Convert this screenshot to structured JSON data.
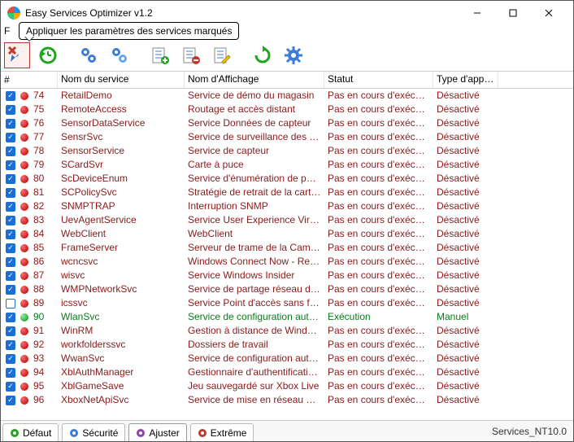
{
  "window": {
    "title": "Easy Services Optimizer v1.2",
    "letter": "F"
  },
  "tooltip": "Appliquer les paramètres des services marqués",
  "toolbar": {
    "apply": "apply-marked",
    "restore": "restore-defaults",
    "service1": "service-settings-1",
    "service2": "service-settings-2",
    "listAdd": "list-add",
    "listRemove": "list-remove",
    "listEdit": "list-edit",
    "refresh": "refresh",
    "options": "options"
  },
  "columns": {
    "idx": "#",
    "name": "Nom du service",
    "display": "Nom d'Affichage",
    "status": "Statut",
    "type": "Type d'appli..."
  },
  "rows": [
    {
      "n": 74,
      "chk": true,
      "color": "red",
      "name": "RetailDemo",
      "disp": "Service de démo du magasin",
      "stat": "Pas en cours d'exécution",
      "type": "Désactivé",
      "cls": "stopped"
    },
    {
      "n": 75,
      "chk": true,
      "color": "red",
      "name": "RemoteAccess",
      "disp": "Routage et accès distant",
      "stat": "Pas en cours d'exécution",
      "type": "Désactivé",
      "cls": "stopped"
    },
    {
      "n": 76,
      "chk": true,
      "color": "red",
      "name": "SensorDataService",
      "disp": "Service Données de capteur",
      "stat": "Pas en cours d'exécution",
      "type": "Désactivé",
      "cls": "stopped"
    },
    {
      "n": 77,
      "chk": true,
      "color": "red",
      "name": "SensrSvc",
      "disp": "Service de surveillance des cap...",
      "stat": "Pas en cours d'exécution",
      "type": "Désactivé",
      "cls": "stopped"
    },
    {
      "n": 78,
      "chk": true,
      "color": "red",
      "name": "SensorService",
      "disp": "Service de capteur",
      "stat": "Pas en cours d'exécution",
      "type": "Désactivé",
      "cls": "stopped"
    },
    {
      "n": 79,
      "chk": true,
      "color": "red",
      "name": "SCardSvr",
      "disp": "Carte à puce",
      "stat": "Pas en cours d'exécution",
      "type": "Désactivé",
      "cls": "stopped"
    },
    {
      "n": 80,
      "chk": true,
      "color": "red",
      "name": "ScDeviceEnum",
      "disp": "Service d'énumération de périp...",
      "stat": "Pas en cours d'exécution",
      "type": "Désactivé",
      "cls": "stopped"
    },
    {
      "n": 81,
      "chk": true,
      "color": "red",
      "name": "SCPolicySvc",
      "disp": "Stratégie de retrait de la carte ...",
      "stat": "Pas en cours d'exécution",
      "type": "Désactivé",
      "cls": "stopped"
    },
    {
      "n": 82,
      "chk": true,
      "color": "red",
      "name": "SNMPTRAP",
      "disp": "Interruption SNMP",
      "stat": "Pas en cours d'exécution",
      "type": "Désactivé",
      "cls": "stopped"
    },
    {
      "n": 83,
      "chk": true,
      "color": "red",
      "name": "UevAgentService",
      "disp": "Service User Experience Virtuali...",
      "stat": "Pas en cours d'exécution",
      "type": "Désactivé",
      "cls": "stopped"
    },
    {
      "n": 84,
      "chk": true,
      "color": "red",
      "name": "WebClient",
      "disp": "WebClient",
      "stat": "Pas en cours d'exécution",
      "type": "Désactivé",
      "cls": "stopped"
    },
    {
      "n": 85,
      "chk": true,
      "color": "red",
      "name": "FrameServer",
      "disp": "Serveur de trame de la Caméra...",
      "stat": "Pas en cours d'exécution",
      "type": "Désactivé",
      "cls": "stopped"
    },
    {
      "n": 86,
      "chk": true,
      "color": "red",
      "name": "wcncsvc",
      "disp": "Windows Connect Now - Regist...",
      "stat": "Pas en cours d'exécution",
      "type": "Désactivé",
      "cls": "stopped"
    },
    {
      "n": 87,
      "chk": true,
      "color": "red",
      "name": "wisvc",
      "disp": "Service Windows Insider",
      "stat": "Pas en cours d'exécution",
      "type": "Désactivé",
      "cls": "stopped"
    },
    {
      "n": 88,
      "chk": true,
      "color": "red",
      "name": "WMPNetworkSvc",
      "disp": "Service de partage réseau du L...",
      "stat": "Pas en cours d'exécution",
      "type": "Désactivé",
      "cls": "stopped"
    },
    {
      "n": 89,
      "chk": false,
      "color": "red",
      "name": "icssvc",
      "disp": "Service Point d'accès sans fil m...",
      "stat": "Pas en cours d'exécution",
      "type": "Désactivé",
      "cls": "stopped"
    },
    {
      "n": 90,
      "chk": true,
      "color": "green",
      "name": "WlanSvc",
      "disp": "Service de configuration autom...",
      "stat": "Exécution",
      "type": "Manuel",
      "cls": "running"
    },
    {
      "n": 91,
      "chk": true,
      "color": "red",
      "name": "WinRM",
      "disp": "Gestion à distance de Windows...",
      "stat": "Pas en cours d'exécution",
      "type": "Désactivé",
      "cls": "stopped"
    },
    {
      "n": 92,
      "chk": true,
      "color": "red",
      "name": "workfolderssvc",
      "disp": "Dossiers de travail",
      "stat": "Pas en cours d'exécution",
      "type": "Désactivé",
      "cls": "stopped"
    },
    {
      "n": 93,
      "chk": true,
      "color": "red",
      "name": "WwanSvc",
      "disp": "Service de configuration autom...",
      "stat": "Pas en cours d'exécution",
      "type": "Désactivé",
      "cls": "stopped"
    },
    {
      "n": 94,
      "chk": true,
      "color": "red",
      "name": "XblAuthManager",
      "disp": "Gestionnaire d'authentification ...",
      "stat": "Pas en cours d'exécution",
      "type": "Désactivé",
      "cls": "stopped"
    },
    {
      "n": 95,
      "chk": true,
      "color": "red",
      "name": "XblGameSave",
      "disp": "Jeu sauvegardé sur Xbox Live",
      "stat": "Pas en cours d'exécution",
      "type": "Désactivé",
      "cls": "stopped"
    },
    {
      "n": 96,
      "chk": true,
      "color": "red",
      "name": "XboxNetApiSvc",
      "disp": "Service de mise en réseau Xbo...",
      "stat": "Pas en cours d'exécution",
      "type": "Désactivé",
      "cls": "stopped"
    }
  ],
  "tabs": {
    "default": "Défaut",
    "security": "Sécurité",
    "adjust": "Ajuster",
    "extreme": "Extrême"
  },
  "status": "Services_NT10.0"
}
